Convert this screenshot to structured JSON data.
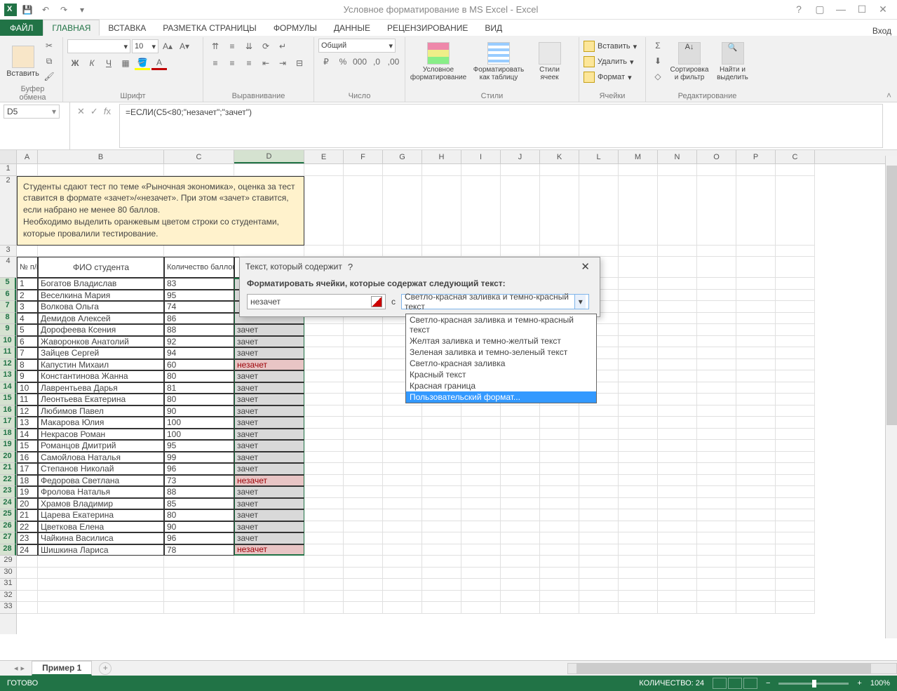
{
  "title": "Условное форматирование в MS Excel - Excel",
  "signin": "Вход",
  "tabs": {
    "file": "ФАЙЛ",
    "home": "ГЛАВНАЯ",
    "insert": "ВСТАВКА",
    "layout": "РАЗМЕТКА СТРАНИЦЫ",
    "formulas": "ФОРМУЛЫ",
    "data": "ДАННЫЕ",
    "review": "РЕЦЕНЗИРОВАНИЕ",
    "view": "ВИД"
  },
  "ribbon": {
    "clipboard": {
      "paste": "Вставить",
      "label": "Буфер обмена"
    },
    "font": {
      "size": "10",
      "label": "Шрифт"
    },
    "align": {
      "label": "Выравнивание"
    },
    "number": {
      "general": "Общий",
      "label": "Число"
    },
    "styles": {
      "cond": "Условное форматирование",
      "table": "Форматировать как таблицу",
      "cell": "Стили ячеек",
      "label": "Стили"
    },
    "cells": {
      "insert": "Вставить",
      "delete": "Удалить",
      "format": "Формат",
      "label": "Ячейки"
    },
    "editing": {
      "sort": "Сортировка и фильтр",
      "find": "Найти и выделить",
      "label": "Редактирование"
    }
  },
  "namebox": "D5",
  "formula": "=ЕСЛИ(C5<80;\"незачет\";\"зачет\")",
  "columns": [
    "A",
    "B",
    "C",
    "D",
    "E",
    "F",
    "G",
    "H",
    "I",
    "J",
    "K",
    "L",
    "M",
    "N",
    "O",
    "P",
    "C"
  ],
  "note": "Студенты сдают тест по теме «Рыночная экономика», оценка за тест ставится в формате «зачет»/«незачет». При этом «зачет» ставится, если набрано не менее 80 баллов.\nНеобходимо выделить оранжевым цветом строки со студентами, которые провалили тестирование.",
  "headers": {
    "num": "№ п/п",
    "fio": "ФИО студента",
    "score": "Количество баллов"
  },
  "rows": [
    {
      "n": "1",
      "name": "Богатов Владислав",
      "score": "83",
      "res": ""
    },
    {
      "n": "2",
      "name": "Веселкина Мария",
      "score": "95",
      "res": ""
    },
    {
      "n": "3",
      "name": "Волкова Ольга",
      "score": "74",
      "res": ""
    },
    {
      "n": "4",
      "name": "Демидов Алексей",
      "score": "86",
      "res": ""
    },
    {
      "n": "5",
      "name": "Дорофеева Ксения",
      "score": "88",
      "res": "зачет"
    },
    {
      "n": "6",
      "name": "Жаворонков Анатолий",
      "score": "92",
      "res": "зачет"
    },
    {
      "n": "7",
      "name": "Зайцев Сергей",
      "score": "94",
      "res": "зачет"
    },
    {
      "n": "8",
      "name": "Капустин Михаил",
      "score": "60",
      "res": "незачет"
    },
    {
      "n": "9",
      "name": "Константинова Жанна",
      "score": "80",
      "res": "зачет"
    },
    {
      "n": "10",
      "name": "Лаврентьева Дарья",
      "score": "81",
      "res": "зачет"
    },
    {
      "n": "11",
      "name": "Леонтьева Екатерина",
      "score": "80",
      "res": "зачет"
    },
    {
      "n": "12",
      "name": "Любимов Павел",
      "score": "90",
      "res": "зачет"
    },
    {
      "n": "13",
      "name": "Макарова Юлия",
      "score": "100",
      "res": "зачет"
    },
    {
      "n": "14",
      "name": "Некрасов Роман",
      "score": "100",
      "res": "зачет"
    },
    {
      "n": "15",
      "name": "Романцов Дмитрий",
      "score": "95",
      "res": "зачет"
    },
    {
      "n": "16",
      "name": "Самойлова Наталья",
      "score": "99",
      "res": "зачет"
    },
    {
      "n": "17",
      "name": "Степанов Николай",
      "score": "96",
      "res": "зачет"
    },
    {
      "n": "18",
      "name": "Федорова Светлана",
      "score": "73",
      "res": "незачет"
    },
    {
      "n": "19",
      "name": "Фролова Наталья",
      "score": "88",
      "res": "зачет"
    },
    {
      "n": "20",
      "name": "Храмов Владимир",
      "score": "85",
      "res": "зачет"
    },
    {
      "n": "21",
      "name": "Царева Екатерина",
      "score": "80",
      "res": "зачет"
    },
    {
      "n": "22",
      "name": "Цветкова Елена",
      "score": "90",
      "res": "зачет"
    },
    {
      "n": "23",
      "name": "Чайкина Василиса",
      "score": "96",
      "res": "зачет"
    },
    {
      "n": "24",
      "name": "Шишкина Лариса",
      "score": "78",
      "res": "незачет"
    }
  ],
  "dialog": {
    "title": "Текст, который содержит",
    "label": "Форматировать ячейки, которые содержат следующий текст:",
    "value": "незачет",
    "c": "с",
    "selection": "Светло-красная заливка и темно-красный текст",
    "options": [
      "Светло-красная заливка и темно-красный текст",
      "Желтая заливка и темно-желтый текст",
      "Зеленая заливка и темно-зеленый текст",
      "Светло-красная заливка",
      "Красный текст",
      "Красная граница",
      "Пользовательский формат..."
    ]
  },
  "sheet": "Пример 1",
  "status": {
    "ready": "ГОТОВО",
    "count": "КОЛИЧЕСТВО: 24",
    "zoom": "100%"
  }
}
